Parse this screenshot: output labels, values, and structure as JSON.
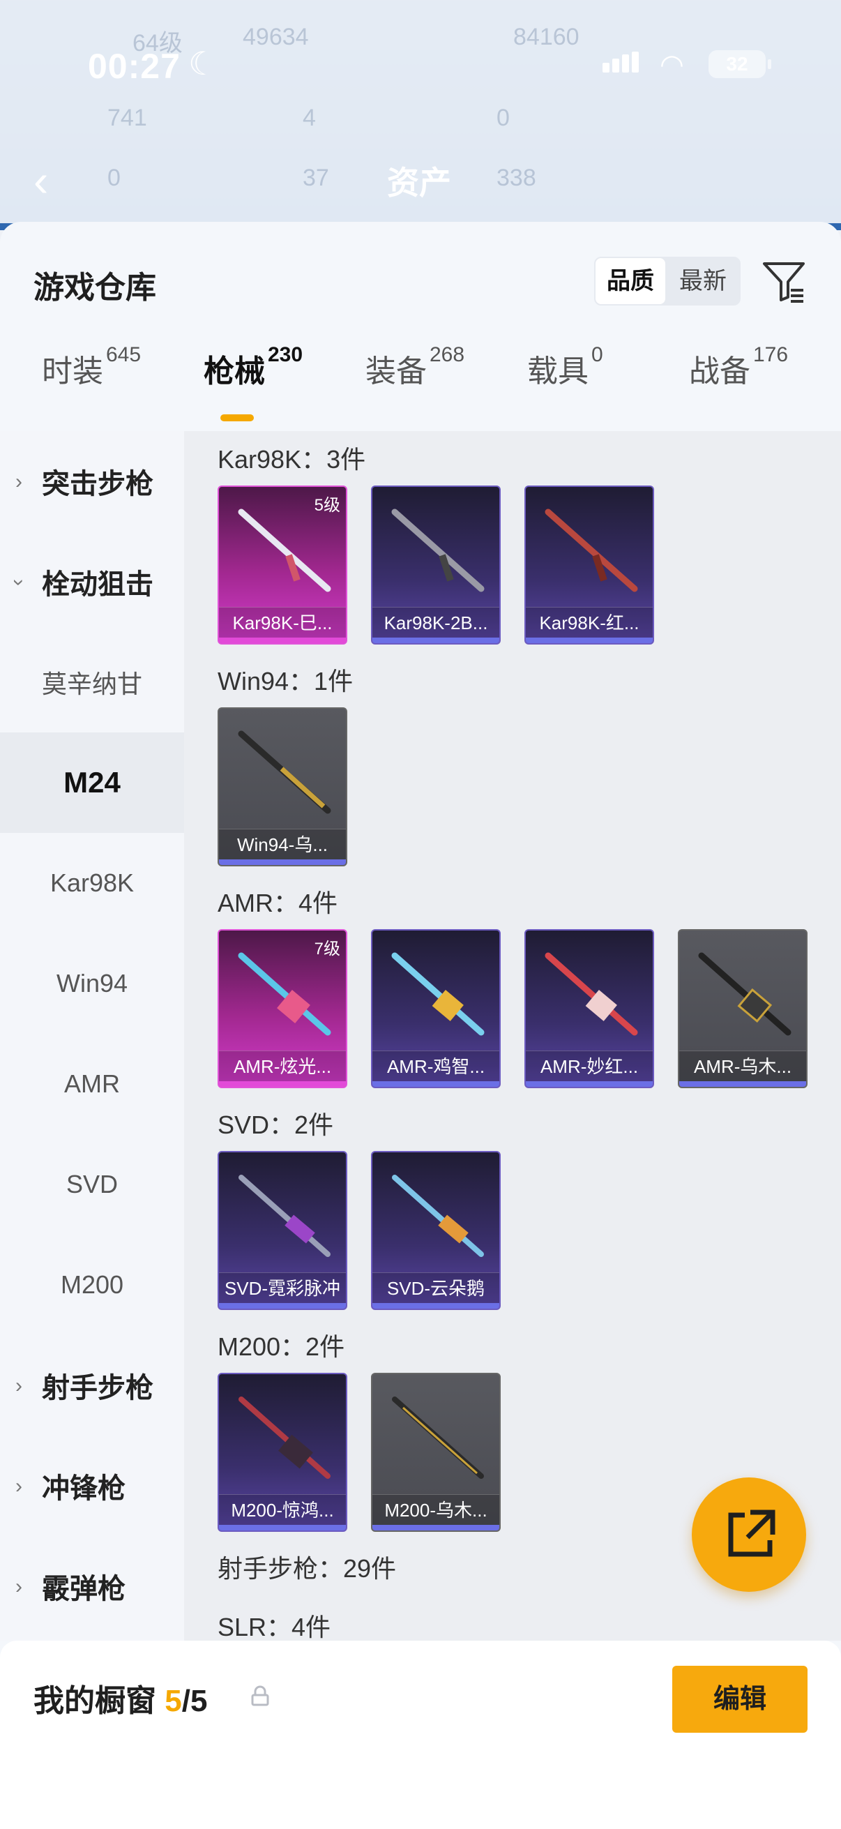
{
  "status": {
    "time": "00:27",
    "battery": "32"
  },
  "nav": {
    "title": "资产"
  },
  "bg_stats": {
    "level": "64级",
    "coins": "49634",
    "score": "84160",
    "s1": "741",
    "s2": "4",
    "s3": "0",
    "s4": "0",
    "s5": "37",
    "s6": "338"
  },
  "header": {
    "title": "游戏仓库",
    "sort_quality": "品质",
    "sort_newest": "最新"
  },
  "tabs": [
    {
      "label": "时装",
      "count": "645"
    },
    {
      "label": "枪械",
      "count": "230"
    },
    {
      "label": "装备",
      "count": "268"
    },
    {
      "label": "载具",
      "count": "0"
    },
    {
      "label": "战备",
      "count": "176"
    }
  ],
  "sidebar": [
    "突击步枪",
    "栓动狙击",
    "莫辛纳甘",
    "M24",
    "Kar98K",
    "Win94",
    "AMR",
    "SVD",
    "M200",
    "射手步枪",
    "冲锋枪",
    "霰弹枪"
  ],
  "sections": {
    "kar98k": "Kar98K：3件",
    "win94": "Win94：1件",
    "amr": "AMR：4件",
    "svd": "SVD：2件",
    "m200": "M200：2件",
    "dmr": "射手步枪：29件",
    "slr": "SLR：4件"
  },
  "items": {
    "k1": {
      "name": "Kar98K-巳...",
      "level": "5级"
    },
    "k2": {
      "name": "Kar98K-2B..."
    },
    "k3": {
      "name": "Kar98K-红..."
    },
    "w1": {
      "name": "Win94-乌..."
    },
    "a1": {
      "name": "AMR-炫光...",
      "level": "7级"
    },
    "a2": {
      "name": "AMR-鸡智..."
    },
    "a3": {
      "name": "AMR-妙红..."
    },
    "a4": {
      "name": "AMR-乌木..."
    },
    "s1": {
      "name": "SVD-霓彩脉冲"
    },
    "s2": {
      "name": "SVD-云朵鹅"
    },
    "m1": {
      "name": "M200-惊鸿..."
    },
    "m2": {
      "name": "M200-乌木..."
    }
  },
  "showcase": {
    "label": "我的橱窗",
    "current": "5",
    "total": "/5",
    "edit": "编辑"
  },
  "colors": {
    "accent": "#f7a90d",
    "legendary": "#d43ccd",
    "epic": "#5a46a6"
  }
}
